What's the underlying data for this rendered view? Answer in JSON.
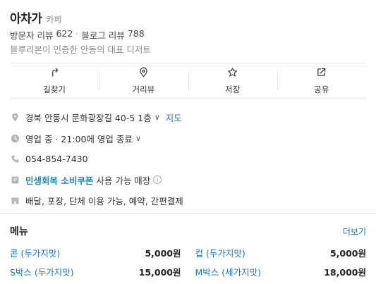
{
  "place": {
    "title": "아차가",
    "category": "카페",
    "reviews": {
      "visitor_label": "방문자 리뷰",
      "visitor_count": "622",
      "separator": "·",
      "blog_label": "블로그 리뷰",
      "blog_count": "788"
    },
    "description": "블루리본이 인증한 안동의 대표 디저트"
  },
  "actions": [
    {
      "label": "길찾기",
      "icon": "directions-icon"
    },
    {
      "label": "거리뷰",
      "icon": "location-pin-icon"
    },
    {
      "label": "저장",
      "icon": "star-icon"
    },
    {
      "label": "공유",
      "icon": "share-icon"
    }
  ],
  "info": {
    "address": "경북 안동시 문화광장길 40-5 1층",
    "map_link": "지도",
    "hours_status": "영업 중",
    "hours_detail": "· 21:00에 영업 종료",
    "phone": "054-854-7430",
    "coupon_name": "민생회복 소비쿠폰",
    "coupon_text": "사용 가능 매장",
    "services": "배달, 포장, 단체 이용 가능, 예약, 간편결제"
  },
  "menu": {
    "title": "메뉴",
    "more_label": "더보기",
    "items": [
      {
        "name": "콘 (두가지맛)",
        "price": "5,000원"
      },
      {
        "name": "컵 (두가지맛)",
        "price": "5,000원"
      },
      {
        "name": "S박스 (두가지맛)",
        "price": "15,000원"
      },
      {
        "name": "M박스 (세가지맛)",
        "price": "18,000원"
      }
    ]
  },
  "colors": {
    "link": "#1a73c8",
    "coupon": "#1a8ac6",
    "muted": "#888888"
  }
}
